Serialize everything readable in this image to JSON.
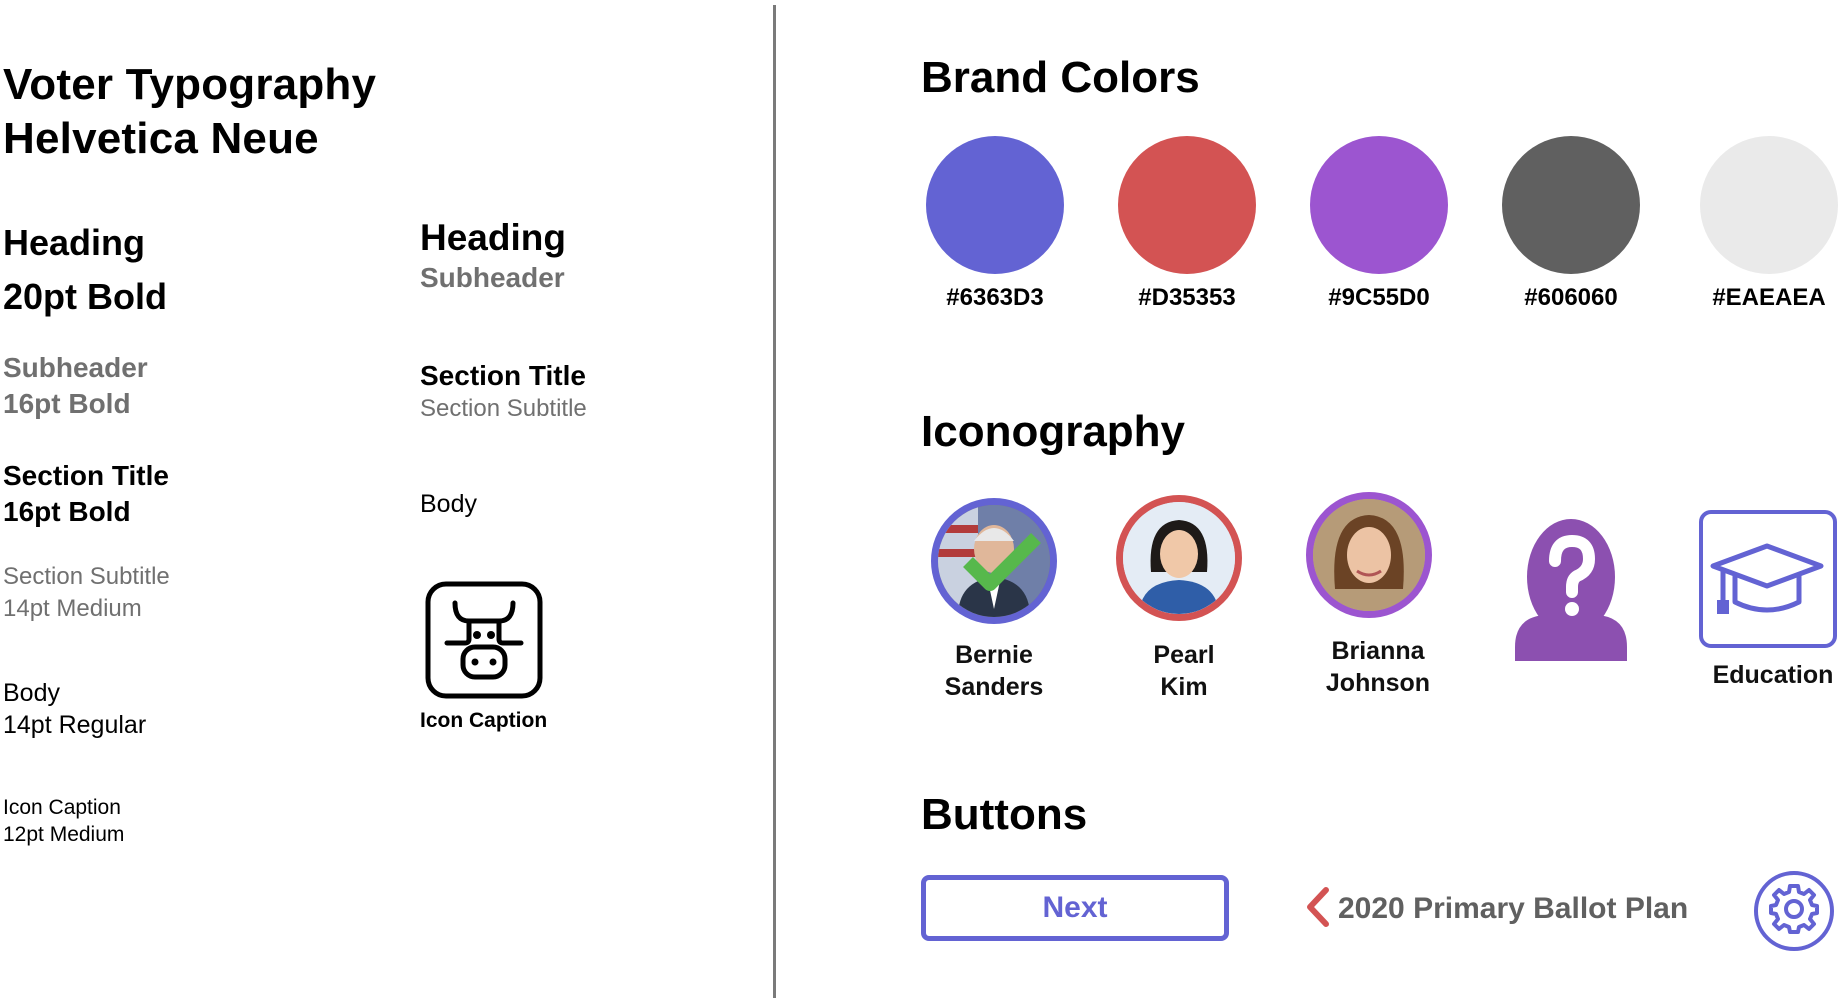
{
  "typography": {
    "title_line1": "Voter Typography",
    "title_line2": "Helvetica Neue",
    "specs": {
      "heading_name": "Heading",
      "heading_spec": "20pt Bold",
      "subheader_name": "Subheader",
      "subheader_spec": "16pt Bold",
      "section_title_name": "Section Title",
      "section_title_spec": "16pt Bold",
      "section_subtitle_name": "Section Subtitle",
      "section_subtitle_spec": "14pt Medium",
      "body_name": "Body",
      "body_spec": "14pt Regular",
      "icon_caption_name": "Icon Caption",
      "icon_caption_spec": "12pt Medium"
    },
    "samples": {
      "heading": "Heading",
      "subheader": "Subheader",
      "section_title": "Section Title",
      "section_subtitle": "Section Subtitle",
      "body": "Body",
      "icon_caption": "Icon Caption",
      "icon": "cow-icon"
    }
  },
  "brand_colors": {
    "heading": "Brand Colors",
    "swatches": [
      {
        "hex": "#6363D3",
        "label": "#6363D3"
      },
      {
        "hex": "#D35353",
        "label": "#D35353"
      },
      {
        "hex": "#9C55D0",
        "label": "#9C55D0"
      },
      {
        "hex": "#606060",
        "label": "#606060"
      },
      {
        "hex": "#EAEAEA",
        "label": "#EAEAEA"
      }
    ]
  },
  "iconography": {
    "heading": "Iconography",
    "items": [
      {
        "line1": "Bernie",
        "line2": "Sanders",
        "ring_color": "#6363D3",
        "icon": "candidate-photo-with-check"
      },
      {
        "line1": "Pearl",
        "line2": "Kim",
        "ring_color": "#D35353",
        "icon": "candidate-photo"
      },
      {
        "line1": "Brianna",
        "line2": "Johnson",
        "ring_color": "#9C55D0",
        "icon": "candidate-photo"
      },
      {
        "icon": "unknown-person-icon",
        "color": "#8C50B0"
      },
      {
        "label": "Education",
        "icon": "graduation-cap-icon",
        "color": "#6363D3"
      }
    ]
  },
  "buttons": {
    "heading": "Buttons",
    "next_label": "Next",
    "back_label": "2020 Primary Ballot Plan",
    "back_icon": "chevron-left-icon",
    "settings_icon": "gear-icon"
  }
}
